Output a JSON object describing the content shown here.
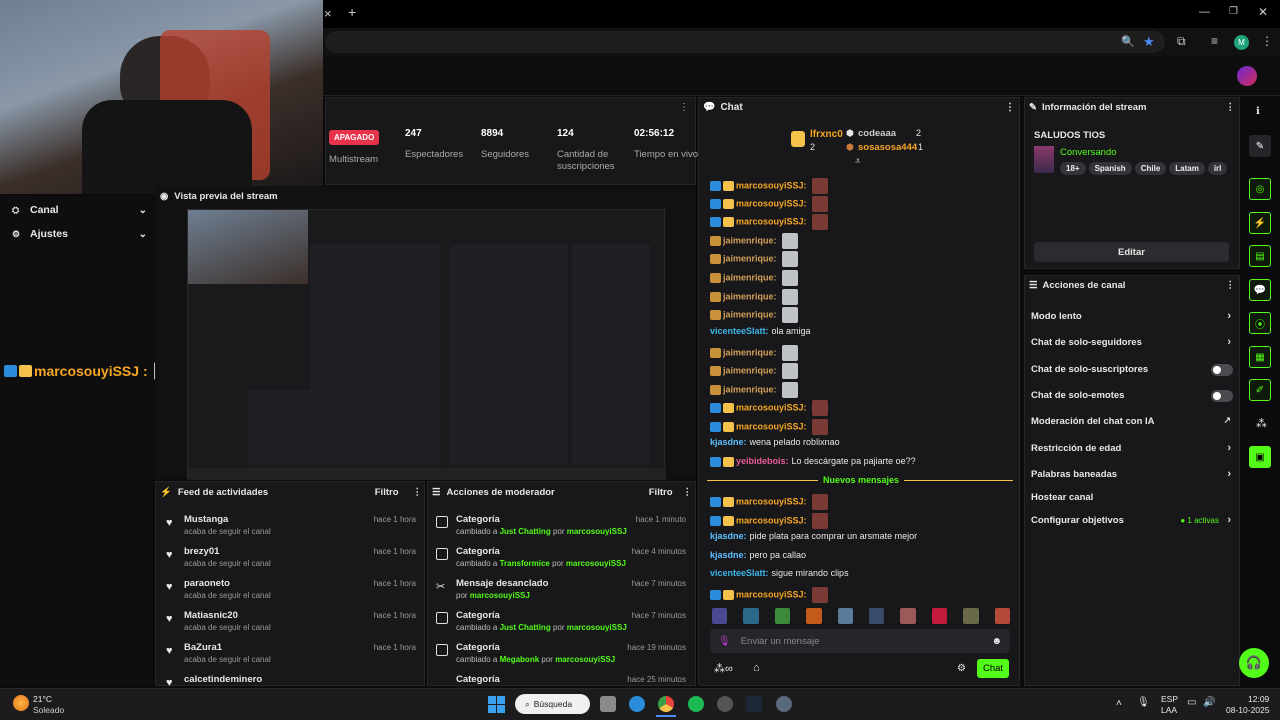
{
  "browser": {
    "tab_close": "×",
    "tab_new": "+",
    "profile_initial": "M"
  },
  "stream_header": {
    "status_badge": "APAGADO",
    "multistream": "Multistream",
    "stats": [
      {
        "value": "247",
        "label": "Espectadores"
      },
      {
        "value": "8894",
        "label": "Seguidores"
      },
      {
        "value": "124",
        "label": "Cantidad de suscripciones"
      },
      {
        "value": "02:56:12",
        "label": "Tiempo en vivo"
      }
    ]
  },
  "sidebar": {
    "items": [
      {
        "label": "Canal"
      },
      {
        "label": "Ajustes"
      }
    ]
  },
  "overlay_user": {
    "name": "marcosouyiSSJ :"
  },
  "preview": {
    "title": "Vista previa del stream"
  },
  "chat": {
    "title": "Chat",
    "top_users": [
      {
        "name": "lfrxnc0",
        "count": "2"
      },
      {
        "name": "codeaaa",
        "count": "2"
      },
      {
        "name": "sosasosa444",
        "count": "1"
      }
    ],
    "messages": [
      {
        "user": "marcosouyiSSJ:",
        "text": ""
      },
      {
        "user": "marcosouyiSSJ:",
        "text": ""
      },
      {
        "user": "marcosouyiSSJ:",
        "text": ""
      },
      {
        "user": "jaimenrique:",
        "text": ""
      },
      {
        "user": "jaimenrique:",
        "text": ""
      },
      {
        "user": "jaimenrique:",
        "text": ""
      },
      {
        "user": "jaimenrique:",
        "text": ""
      },
      {
        "user": "jaimenrique:",
        "text": ""
      },
      {
        "user": "vicenteeSlatt:",
        "text": "ola amiga"
      },
      {
        "user": "jaimenrique:",
        "text": ""
      },
      {
        "user": "jaimenrique:",
        "text": ""
      },
      {
        "user": "jaimenrique:",
        "text": ""
      },
      {
        "user": "marcosouyiSSJ:",
        "text": ""
      },
      {
        "user": "marcosouyiSSJ:",
        "text": ""
      },
      {
        "user": "kjasdne:",
        "text": "wena pelado roblixnao"
      },
      {
        "user": "yeibidebois:",
        "text": "Lo descárgate pa pajiarte oe??"
      },
      {
        "user": "marcosouyiSSJ:",
        "text": ""
      },
      {
        "user": "marcosouyiSSJ:",
        "text": ""
      },
      {
        "user": "kjasdne:",
        "text": "pide plata para comprar un arsmate mejor"
      },
      {
        "user": "kjasdne:",
        "text": "pero pa callao"
      },
      {
        "user": "vicenteeSlatt:",
        "text": "sigue mirando clips"
      },
      {
        "user": "marcosouyiSSJ:",
        "text": ""
      }
    ],
    "new_messages": "Nuevos mensajes",
    "input_placeholder": "Enviar un mensaje",
    "send_label": "Chat"
  },
  "stream_info": {
    "title": "Información del stream",
    "stream_title": "SALUDOS TIOS",
    "category": "Conversando",
    "tags": [
      "18+",
      "Spanish",
      "Chile",
      "Latam",
      "irl"
    ],
    "edit_label": "Editar"
  },
  "channel_actions": {
    "title": "Acciones de canal",
    "items": [
      {
        "label": "Modo lento"
      },
      {
        "label": "Chat de solo-seguidores"
      },
      {
        "label": "Chat de solo-suscriptores"
      },
      {
        "label": "Chat de solo-emotes"
      },
      {
        "label": "Moderación del chat con IA"
      },
      {
        "label": "Restricción de edad"
      },
      {
        "label": "Palabras baneadas"
      },
      {
        "label": "Hostear canal"
      },
      {
        "label": "Configurar objetivos"
      }
    ],
    "goals_active": "1 activas"
  },
  "activity_feed": {
    "title": "Feed de actividades",
    "filter": "Filtro",
    "items": [
      {
        "name": "Mustanga",
        "sub": "acaba de seguir el canal",
        "time": "hace 1 hora"
      },
      {
        "name": "brezy01",
        "sub": "acaba de seguir el canal",
        "time": "hace 1 hora"
      },
      {
        "name": "paraoneto",
        "sub": "acaba de seguir el canal",
        "time": "hace 1 hora"
      },
      {
        "name": "Matiasnic20",
        "sub": "acaba de seguir el canal",
        "time": "hace 1 hora"
      },
      {
        "name": "BaZura1",
        "sub": "acaba de seguir el canal",
        "time": "hace 1 hora"
      },
      {
        "name": "calcetindeminero",
        "sub": "",
        "time": ""
      }
    ]
  },
  "mod_actions": {
    "title": "Acciones de moderador",
    "filter": "Filtro",
    "items": [
      {
        "name": "Categoría",
        "pre": "cambiado a",
        "cat": "Just Chatting",
        "mid": "por",
        "by": "marcosouyiSSJ",
        "time": "hace 1 minuto"
      },
      {
        "name": "Categoría",
        "pre": "cambiado a",
        "cat": "Transformice",
        "mid": "por",
        "by": "marcosouyiSSJ",
        "time": "hace 4 minutos"
      },
      {
        "name": "Mensaje desanclado",
        "pre": "por",
        "cat": "marcosouyiSSJ",
        "mid": "",
        "by": "",
        "time": "hace 7 minutos"
      },
      {
        "name": "Categoría",
        "pre": "cambiado a",
        "cat": "Just Chatting",
        "mid": "por",
        "by": "marcosouyiSSJ",
        "time": "hace 7 minutos"
      },
      {
        "name": "Categoría",
        "pre": "cambiado a",
        "cat": "Megabonk",
        "mid": "por",
        "by": "marcosouyiSSJ",
        "time": "hace 19 minutos"
      },
      {
        "name": "Categoría",
        "pre": "",
        "cat": "",
        "mid": "",
        "by": "",
        "time": "hace 25 minutos"
      }
    ]
  },
  "taskbar": {
    "weather_temp": "21°C",
    "weather_desc": "Soleado",
    "search": "Búsqueda",
    "lang": "ESP",
    "lang2": "LAA",
    "time": "12:09",
    "date": "08-10-2025"
  },
  "colors": {
    "accent": "#53fc18",
    "offline": "#e8344a",
    "panel": "#18181b"
  }
}
